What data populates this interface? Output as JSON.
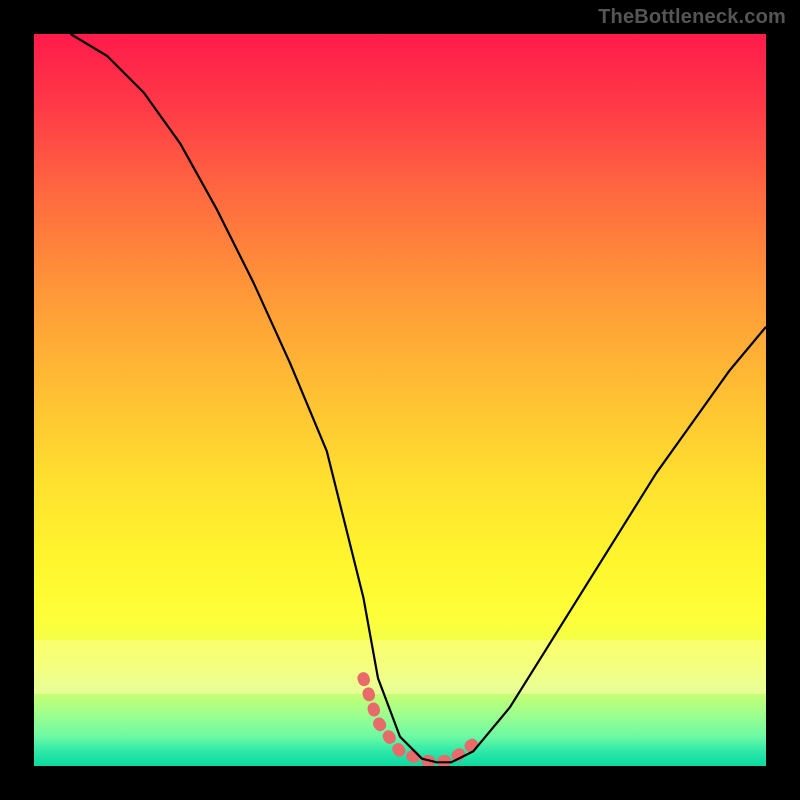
{
  "watermark": "TheBottleneck.com",
  "colors": {
    "frame": "#000000",
    "curve": "#000000",
    "highlight": "#e86a6a",
    "gradient_top": "#ff1b4b",
    "gradient_mid": "#ffe22f",
    "gradient_bottom": "#0bd8a0"
  },
  "chart_data": {
    "type": "line",
    "title": "",
    "xlabel": "",
    "ylabel": "",
    "x_range": [
      0,
      100
    ],
    "y_range": [
      0,
      100
    ],
    "series": [
      {
        "name": "bottleneck-curve",
        "x": [
          5,
          10,
          15,
          20,
          25,
          30,
          35,
          40,
          45,
          47,
          50,
          53,
          55,
          57,
          60,
          65,
          70,
          75,
          80,
          85,
          90,
          95,
          100
        ],
        "y": [
          100,
          97,
          92,
          85,
          76,
          66,
          55,
          43,
          23,
          12,
          4,
          1,
          0.5,
          0.5,
          2,
          8,
          16,
          24,
          32,
          40,
          47,
          54,
          60
        ]
      }
    ],
    "highlight": {
      "name": "valley-highlight",
      "x": [
        45,
        47,
        50,
        53,
        55,
        57,
        60
      ],
      "y": [
        12,
        6,
        2,
        0.8,
        0.5,
        0.8,
        3
      ]
    },
    "background_gradient": {
      "direction": "vertical",
      "stops": [
        {
          "pos": 0.0,
          "color": "#ff1b4b"
        },
        {
          "pos": 0.22,
          "color": "#ff6a3f"
        },
        {
          "pos": 0.5,
          "color": "#ffc233"
        },
        {
          "pos": 0.72,
          "color": "#fff62d"
        },
        {
          "pos": 0.9,
          "color": "#c8ff72"
        },
        {
          "pos": 1.0,
          "color": "#0bd8a0"
        }
      ]
    }
  }
}
